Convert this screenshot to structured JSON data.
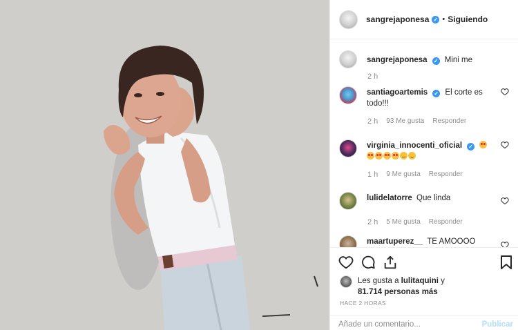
{
  "header": {
    "username": "sangrejaponesa",
    "separator": "•",
    "follow_state": "Siguiendo"
  },
  "comments": [
    {
      "username": "sangrejaponesa",
      "text": "Mini me",
      "time": "2 h",
      "likes": "",
      "reply": ""
    },
    {
      "username": "santiagoartemis",
      "text": "El corte es todo!!!",
      "time": "2 h",
      "likes": "93 Me gusta",
      "reply": "Responder"
    },
    {
      "username": "virginia_innocenti_oficial",
      "text": "",
      "time": "1 h",
      "likes": "9 Me gusta",
      "reply": "Responder"
    },
    {
      "username": "lulidelatorre",
      "text": "Que linda",
      "time": "2 h",
      "likes": "5 Me gusta",
      "reply": "Responder"
    },
    {
      "username": "maartuperez__",
      "text": "TE AMOOOO",
      "time": "",
      "likes": "",
      "reply": ""
    }
  ],
  "likes": {
    "prefix": "Les gusta a ",
    "user": "lulitaquini",
    "suffix": " y",
    "count": "81.714 personas más"
  },
  "time_ago": "HACE 2 HORAS",
  "add_comment": {
    "placeholder": "Añade un comentario...",
    "publish": "Publicar"
  },
  "icons": [
    "heart-icon",
    "comment-icon",
    "share-icon",
    "bookmark-icon",
    "verified-icon"
  ],
  "colors": {
    "verified": "#3897f0",
    "publish_disabled": "#b2dffc",
    "meta": "#8e8e8e"
  }
}
